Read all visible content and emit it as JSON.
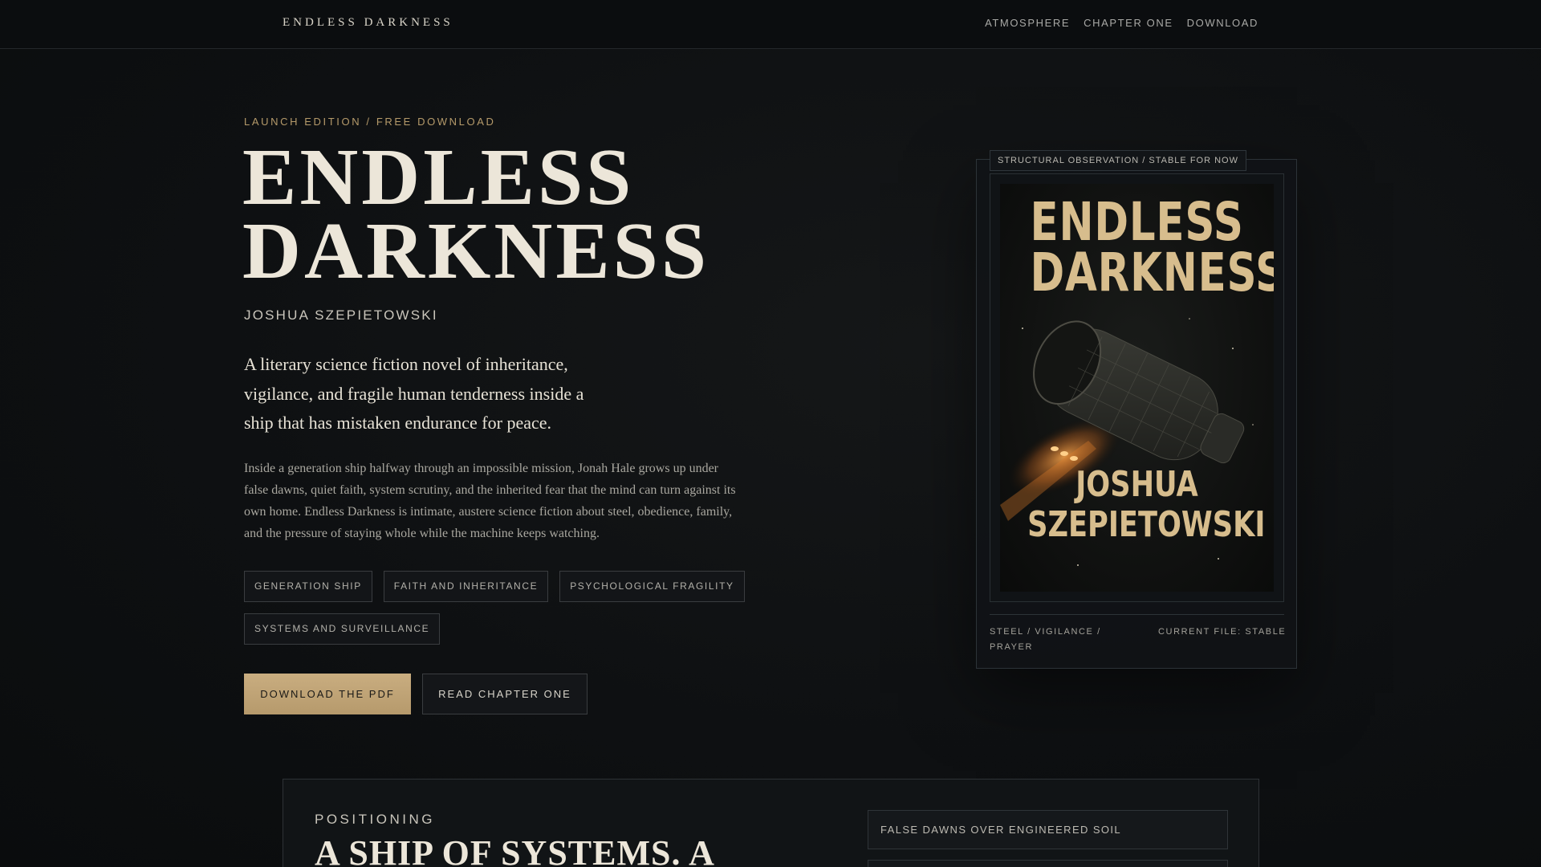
{
  "nav": {
    "brand": "ENDLESS DARKNESS",
    "links": [
      "ATMOSPHERE",
      "CHAPTER ONE",
      "DOWNLOAD"
    ]
  },
  "hero": {
    "eyebrow": "LAUNCH EDITION / FREE DOWNLOAD",
    "title_line1": "ENDLESS",
    "title_line2": "DARKNESS",
    "author": "JOSHUA SZEPIETOWSKI",
    "tagline": "A literary science fiction novel of inheritance, vigilance, and fragile human tenderness inside a ship that has mistaken endurance for peace.",
    "description": "Inside a generation ship halfway through an impossible mission, Jonah Hale grows up under false dawns, quiet faith, system scrutiny, and the inherited fear that the mind can turn against its own home. Endless Darkness is intimate, austere science fiction about steel, obedience, family, and the pressure of staying whole while the machine keeps watching.",
    "tags": [
      "GENERATION SHIP",
      "FAITH AND INHERITANCE",
      "PSYCHOLOGICAL FRAGILITY",
      "SYSTEMS AND SURVEILLANCE"
    ],
    "primary_button": "DOWNLOAD THE PDF",
    "secondary_button": "READ CHAPTER ONE"
  },
  "cover_card": {
    "label": "STRUCTURAL OBSERVATION / STABLE FOR NOW",
    "cover_title_line1": "ENDLESS",
    "cover_title_line2": "DARKNESS",
    "cover_author_line1": "JOSHUA",
    "cover_author_line2": "SZEPIETOWSKI",
    "meta_left": "STEEL / VIGILANCE / PRAYER",
    "meta_right": "CURRENT FILE: STABLE"
  },
  "positioning": {
    "eyebrow": "POSITIONING",
    "title": "A SHIP OF SYSTEMS. A",
    "items": [
      "FALSE DAWNS OVER ENGINEERED SOIL",
      ""
    ]
  },
  "colors": {
    "accent": "#c9ad80",
    "background": "#0e1012",
    "text": "#ece6d9"
  }
}
